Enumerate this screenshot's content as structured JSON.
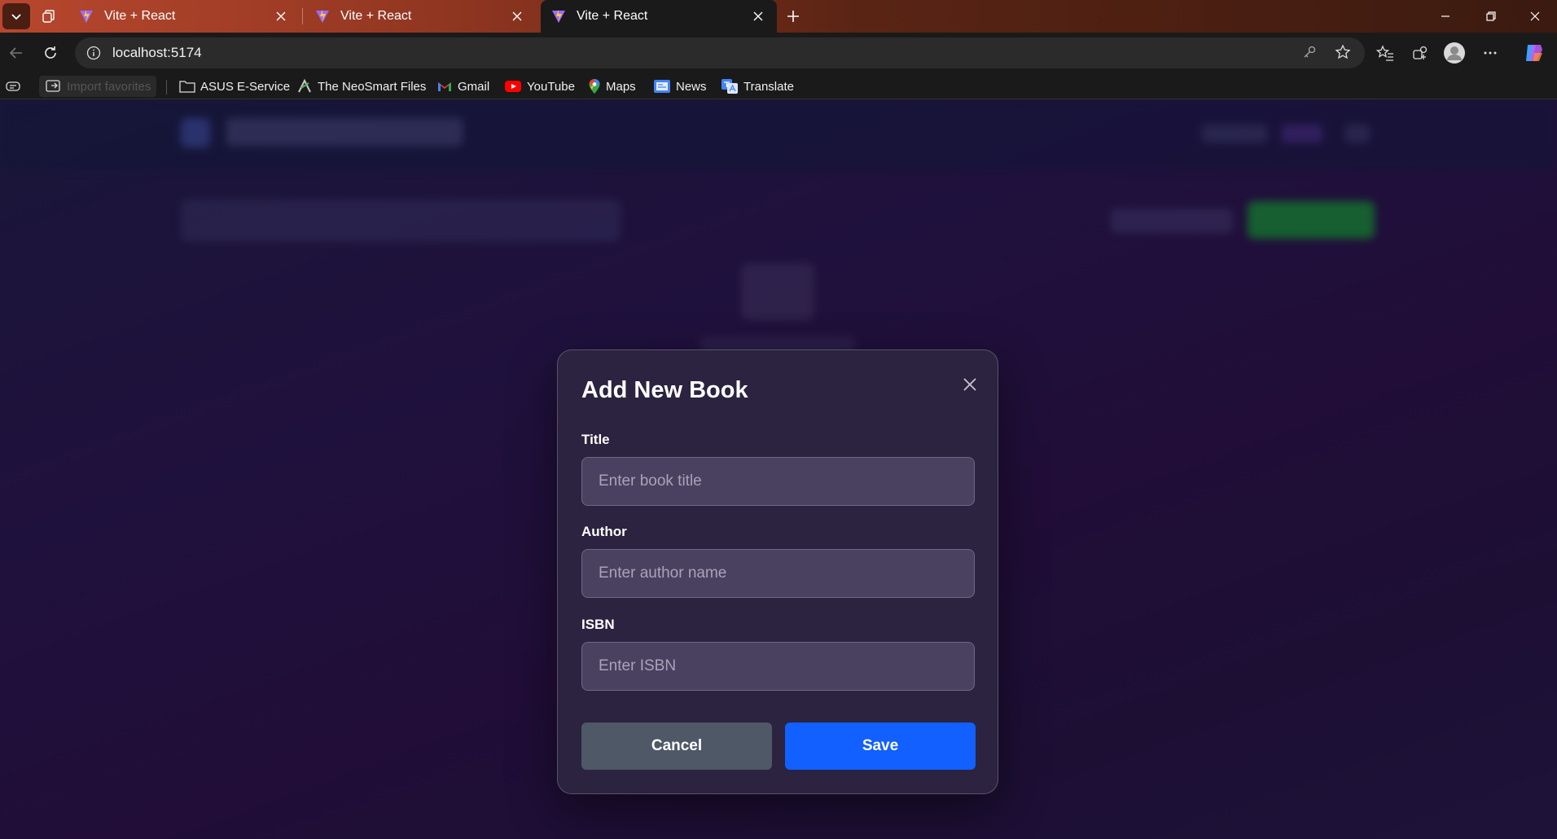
{
  "browser": {
    "tabs": [
      {
        "label": "Vite + React"
      },
      {
        "label": "Vite + React"
      },
      {
        "label": "Vite + React"
      }
    ],
    "address": {
      "url": "localhost:5174"
    },
    "bookmarks": {
      "import_label": "Import favorites",
      "items": [
        {
          "label": "ASUS E-Service",
          "icon": "folder-icon"
        },
        {
          "label": "The NeoSmart Files",
          "icon": "neosmart-icon"
        },
        {
          "label": "Gmail",
          "icon": "gmail-icon"
        },
        {
          "label": "YouTube",
          "icon": "youtube-icon"
        },
        {
          "label": "Maps",
          "icon": "maps-icon"
        },
        {
          "label": "News",
          "icon": "news-icon"
        },
        {
          "label": "Translate",
          "icon": "translate-icon"
        }
      ]
    }
  },
  "modal": {
    "title": "Add New Book",
    "fields": {
      "title": {
        "label": "Title",
        "value": "",
        "placeholder": "Enter book title"
      },
      "author": {
        "label": "Author",
        "value": "",
        "placeholder": "Enter author name"
      },
      "isbn": {
        "label": "ISBN",
        "value": "",
        "placeholder": "Enter ISBN"
      }
    },
    "buttons": {
      "cancel": "Cancel",
      "save": "Save"
    }
  },
  "colors": {
    "save_button": "#1160ff",
    "cancel_button": "#4f5866",
    "tab_accent": "#b8472e"
  }
}
